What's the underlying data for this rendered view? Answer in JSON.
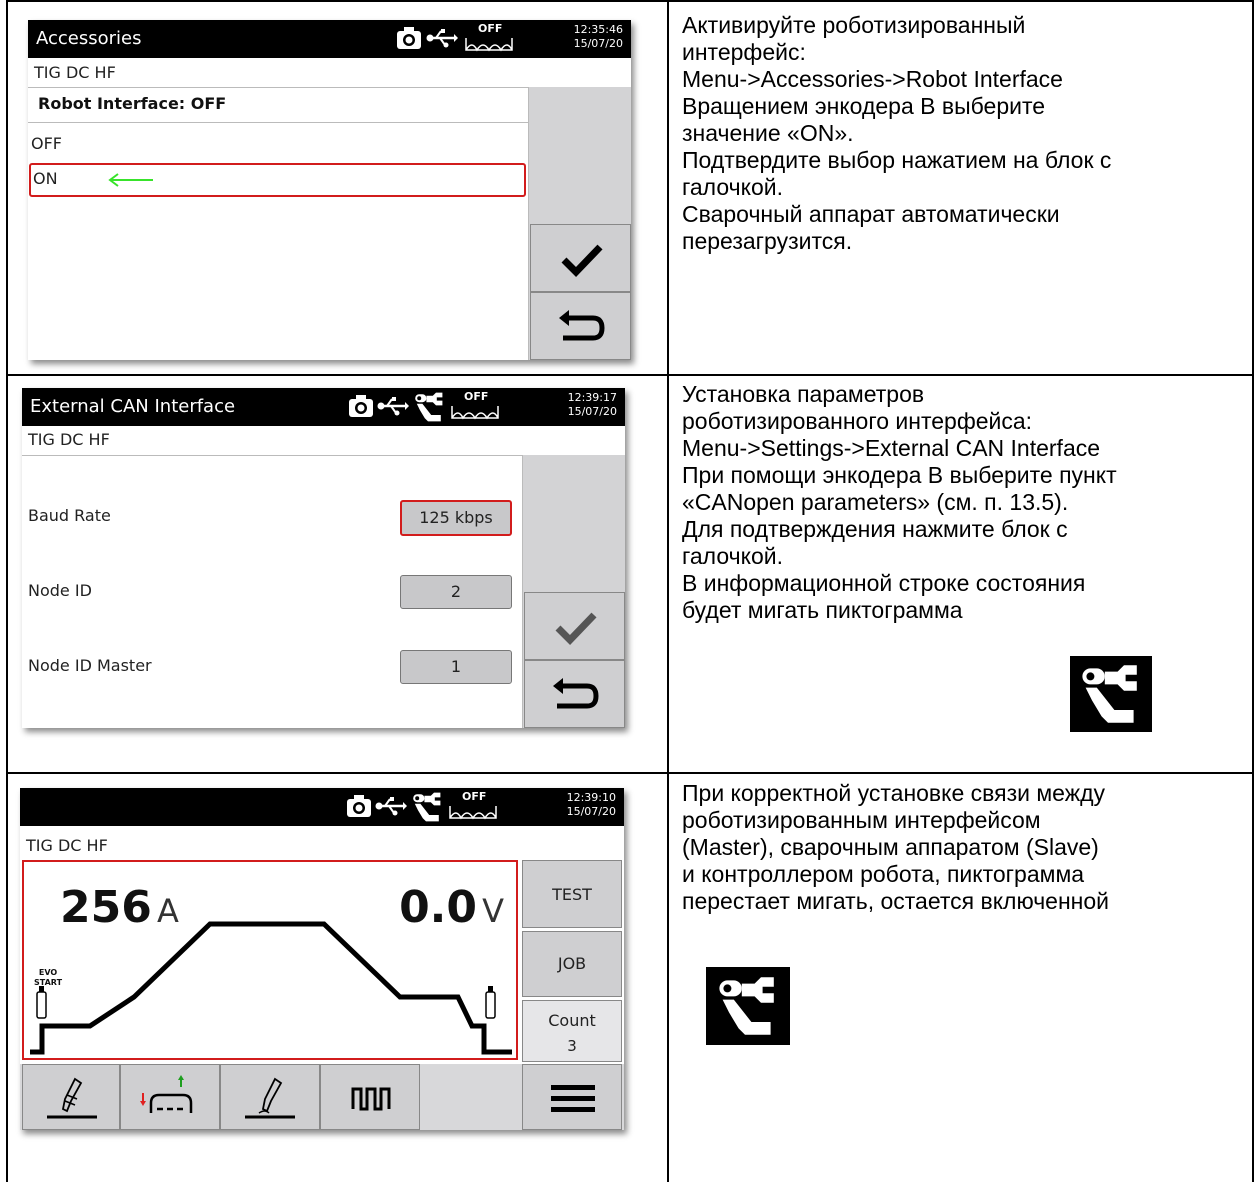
{
  "rows": [
    {
      "screen": {
        "title": "Accessories",
        "time": "12:35:46",
        "date": "15/07/20",
        "off_label": "OFF",
        "mode": "TIG DC HF",
        "heading": "Robot Interface: OFF",
        "options": [
          "OFF",
          "ON"
        ],
        "selected_option": "ON",
        "icons": [
          "camera-icon",
          "usb-icon",
          "wave-off-icon",
          "checkmark-icon",
          "return-icon",
          "arrow-left-icon"
        ]
      },
      "text": "Активируйте роботизированный\nинтерфейс:\nMenu->Accessories->Robot Interface\nВращением энкодера В выберите\nзначение «ON».\nПодтвердите выбор нажатием на блок с\nгалочкой.\nСварочный аппарат автоматически\nперезагрузится."
    },
    {
      "screen": {
        "title": "External CAN Interface",
        "time": "12:39:17",
        "date": "15/07/20",
        "off_label": "OFF",
        "mode": "TIG DC HF",
        "fields": [
          {
            "label": "Baud Rate",
            "value": "125 kbps"
          },
          {
            "label": "Node ID",
            "value": "2"
          },
          {
            "label": "Node ID Master",
            "value": "1"
          }
        ],
        "icons": [
          "camera-icon",
          "usb-icon",
          "robot-icon",
          "wave-off-icon",
          "checkmark-icon",
          "return-icon"
        ]
      },
      "text": "Установка параметров\nроботизированного интерфейса:\nMenu->Settings->External CAN Interface\nПри помощи энкодера В выберите пункт\n«CANopen parameters» (см. п. 13.5).\nДля подтверждения нажмите блок с\nгалочкой.\nВ информационной строке состояния\nбудет мигать пиктограмма"
    },
    {
      "screen": {
        "time": "12:39:10",
        "date": "15/07/20",
        "off_label": "OFF",
        "mode": "TIG DC HF",
        "current_value": "256",
        "current_unit": "A",
        "voltage_value": "0.0",
        "voltage_unit": "V",
        "evo_label": "EVO\nSTART",
        "side_buttons": [
          "TEST",
          "JOB",
          "Count"
        ],
        "count_value": "3",
        "icons": [
          "camera-icon",
          "usb-icon",
          "robot-icon",
          "wave-off-icon",
          "torch-icon",
          "gas-level-icon",
          "torch-wire-icon",
          "pulse-icon",
          "menu-icon"
        ]
      },
      "text": "При корректной установке связи между\nроботизированным интерфейсом\n(Master), сварочным аппаратом (Slave)\nи контроллером робота, пиктограмма\nперестает мигать, остается включенной"
    }
  ]
}
